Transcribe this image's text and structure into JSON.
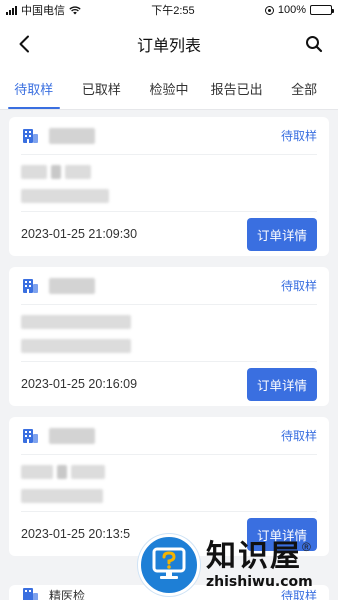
{
  "status_bar": {
    "carrier": "中国电信",
    "time": "下午2:55",
    "battery": "100%"
  },
  "navbar": {
    "title": "订单列表"
  },
  "tabs": [
    {
      "label": "待取样",
      "active": true
    },
    {
      "label": "已取样",
      "active": false
    },
    {
      "label": "检验中",
      "active": false
    },
    {
      "label": "报告已出",
      "active": false
    },
    {
      "label": "全部",
      "active": false
    }
  ],
  "orders": [
    {
      "status": "待取样",
      "time": "2023-01-25 21:09:30",
      "button": "订单详情"
    },
    {
      "status": "待取样",
      "time": "2023-01-25 20:16:09",
      "button": "订单详情"
    },
    {
      "status": "待取样",
      "time": "2023-01-25 20:13:5",
      "button": "订单详情"
    }
  ],
  "partial_order": {
    "label": "精医检",
    "status": "待取样"
  },
  "watermark": {
    "cn": "知识屋",
    "en": "zhishiwu.com",
    "reg": "®"
  },
  "colors": {
    "accent": "#3a6fe0",
    "background": "#f2f3f5",
    "battery": "#2fbf4a",
    "watermark_blue": "#1e7fd6"
  }
}
